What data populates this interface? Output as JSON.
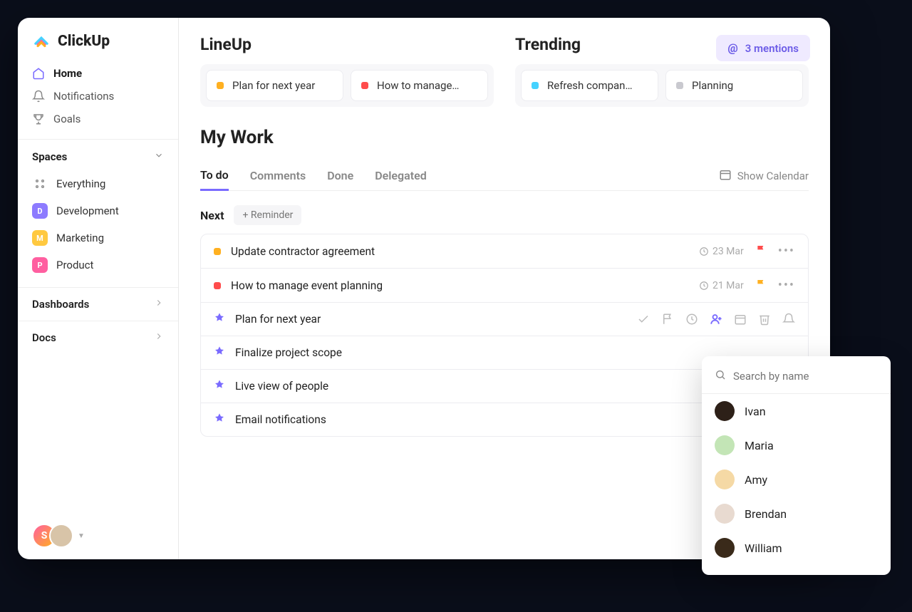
{
  "brand": "ClickUp",
  "nav": {
    "home": "Home",
    "notifications": "Notifications",
    "goals": "Goals"
  },
  "spaces_header": "Spaces",
  "spaces": {
    "everything": "Everything",
    "items": [
      {
        "letter": "D",
        "label": "Development",
        "color": "#8d7bff"
      },
      {
        "letter": "M",
        "label": "Marketing",
        "color": "#ffc940"
      },
      {
        "letter": "P",
        "label": "Product",
        "color": "#ff5fa0"
      }
    ]
  },
  "folders": {
    "dashboards": "Dashboards",
    "docs": "Docs"
  },
  "user_stack": {
    "initial": "S"
  },
  "lineup": {
    "title": "LineUp",
    "cards": [
      {
        "color": "#ffb020",
        "label": "Plan for next year"
      },
      {
        "color": "#ff4c4c",
        "label": "How to manage…"
      }
    ]
  },
  "trending": {
    "title": "Trending",
    "cards": [
      {
        "color": "#45d2ff",
        "label": "Refresh compan…"
      },
      {
        "color": "#c9c9cf",
        "label": "Planning"
      }
    ]
  },
  "mentions": {
    "symbol": "@",
    "label": "3 mentions"
  },
  "mywork": {
    "title": "My Work",
    "tabs": [
      "To do",
      "Comments",
      "Done",
      "Delegated"
    ],
    "show_calendar": "Show Calendar",
    "group_label": "Next",
    "reminder_label": "+ Reminder",
    "tasks": [
      {
        "type": "status",
        "status_color": "#ffb020",
        "title": "Update contractor agreement",
        "date": "23 Mar",
        "flag_color": "#ff4c4c",
        "actions": "more"
      },
      {
        "type": "status",
        "status_color": "#ff4c4c",
        "title": "How to manage event planning",
        "date": "21 Mar",
        "flag_color": "#ffb020",
        "actions": "more"
      },
      {
        "type": "pin",
        "title": "Plan for next year",
        "actions": "toolbar"
      },
      {
        "type": "pin",
        "title": "Finalize project scope"
      },
      {
        "type": "pin",
        "title": "Live view of people"
      },
      {
        "type": "pin",
        "title": "Email notifications"
      }
    ]
  },
  "people_popover": {
    "placeholder": "Search by name",
    "people": [
      {
        "name": "Ivan",
        "bg": "#2d2018"
      },
      {
        "name": "Maria",
        "bg": "#c3e5b6"
      },
      {
        "name": "Amy",
        "bg": "#f5d9a5"
      },
      {
        "name": "Brendan",
        "bg": "#e8dad0"
      },
      {
        "name": "William",
        "bg": "#3a2a1a"
      }
    ]
  }
}
